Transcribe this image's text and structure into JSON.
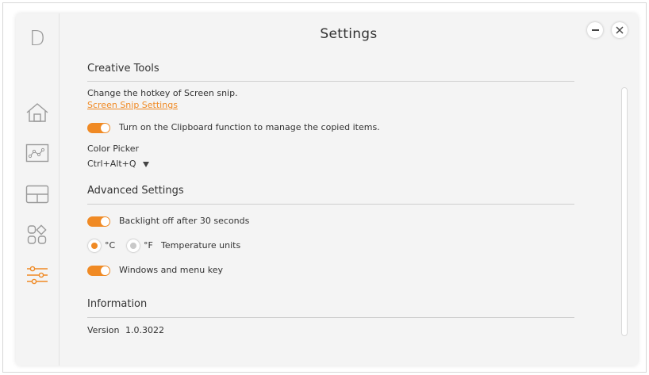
{
  "app": {
    "logo_letter": "D",
    "title": "Settings"
  },
  "window_controls": {
    "minimize_icon": "minus-icon",
    "close_icon": "close-icon"
  },
  "sidebar": {
    "items": [
      {
        "icon": "home-icon",
        "active": false
      },
      {
        "icon": "chart-icon",
        "active": false
      },
      {
        "icon": "layout-icon",
        "active": false
      },
      {
        "icon": "apps-icon",
        "active": false
      },
      {
        "icon": "sliders-icon",
        "active": true
      }
    ]
  },
  "colors": {
    "accent": "#f08a24",
    "background": "#f4f4f4",
    "inactive_icon": "#9a9a9a"
  },
  "creative_tools": {
    "heading": "Creative Tools",
    "screen_snip_desc": "Change the hotkey of Screen snip.",
    "screen_snip_link": "Screen Snip Settings",
    "clipboard_label": "Turn on the Clipboard function to manage the copied items.",
    "clipboard_enabled": true,
    "color_picker_label": "Color Picker",
    "color_picker_hotkey": "Ctrl+Alt+Q"
  },
  "advanced": {
    "heading": "Advanced Settings",
    "backlight_label": "Backlight off after 30 seconds",
    "backlight_enabled": true,
    "celsius_label": "°C",
    "fahrenheit_label": "°F",
    "temperature_selected": "°C",
    "temperature_label": "Temperature units",
    "windows_key_label": "Windows and menu key",
    "windows_key_enabled": true
  },
  "information": {
    "heading": "Information",
    "version_label": "Version",
    "version_value": "1.0.3022"
  }
}
